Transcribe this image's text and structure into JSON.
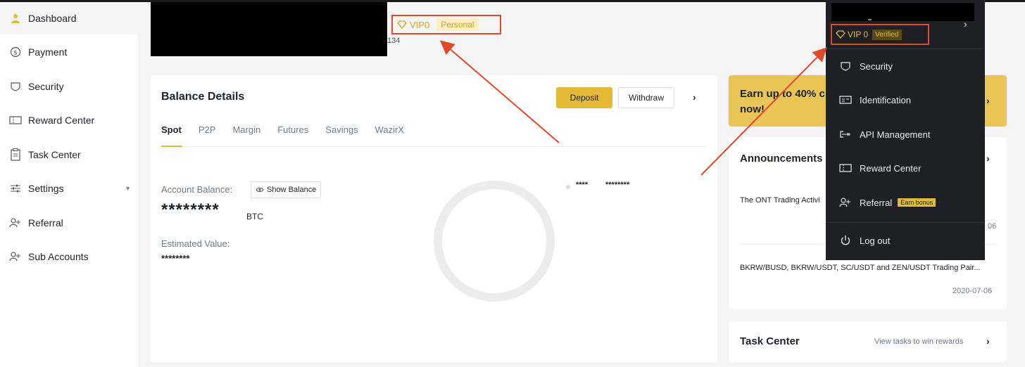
{
  "sidebar": {
    "items": [
      {
        "label": "Dashboard",
        "icon": "user-icon"
      },
      {
        "label": "Payment",
        "icon": "dollar-circle-icon"
      },
      {
        "label": "Security",
        "icon": "shield-icon"
      },
      {
        "label": "Reward Center",
        "icon": "ticket-icon"
      },
      {
        "label": "Task Center",
        "icon": "clipboard-icon"
      },
      {
        "label": "Settings",
        "icon": "sliders-icon"
      },
      {
        "label": "Referral",
        "icon": "add-user-icon"
      },
      {
        "label": "Sub Accounts",
        "icon": "add-user-icon"
      }
    ]
  },
  "header": {
    "uid_suffix": "134",
    "vip_level": "VIP0",
    "account_type": "Personal"
  },
  "balance": {
    "title": "Balance Details",
    "deposit": "Deposit",
    "withdraw": "Withdraw",
    "tabs": [
      "Spot",
      "P2P",
      "Margin",
      "Futures",
      "Savings",
      "WazirX"
    ],
    "account_balance_label": "Account Balance:",
    "show_balance": "Show Balance",
    "balance_masked": "********",
    "unit": "BTC",
    "estimated_label": "Estimated Value:",
    "estimated_masked": "********",
    "legend_name": "****",
    "legend_value": "********"
  },
  "promo": {
    "text": "Earn up to 40% c now!"
  },
  "announcements": {
    "title": "Announcements",
    "items": [
      {
        "text": "The ONT Trading Activi",
        "date": "06"
      },
      {
        "text": "BKRW/BUSD, BKRW/USDT, SC/USDT and ZEN/USDT Trading Pair...",
        "date": "2020-07-06"
      }
    ]
  },
  "task_center": {
    "title": "Task Center",
    "link": "View tasks to win rewards"
  },
  "dropdown": {
    "vip_level": "VIP 0",
    "verified": "Verified",
    "items": [
      {
        "label": "Security",
        "icon": "shield-icon"
      },
      {
        "label": "Identification",
        "icon": "id-card-icon"
      },
      {
        "label": "API Management",
        "icon": "api-key-icon"
      },
      {
        "label": "Reward Center",
        "icon": "ticket-icon"
      },
      {
        "label": "Referral",
        "icon": "add-user-icon",
        "badge": "Earn bonus"
      },
      {
        "label": "Log out",
        "icon": "power-icon"
      }
    ]
  },
  "colors": {
    "accent": "#e3b935",
    "annotation": "#e0492b",
    "dropdown_bg": "#1e2026"
  }
}
